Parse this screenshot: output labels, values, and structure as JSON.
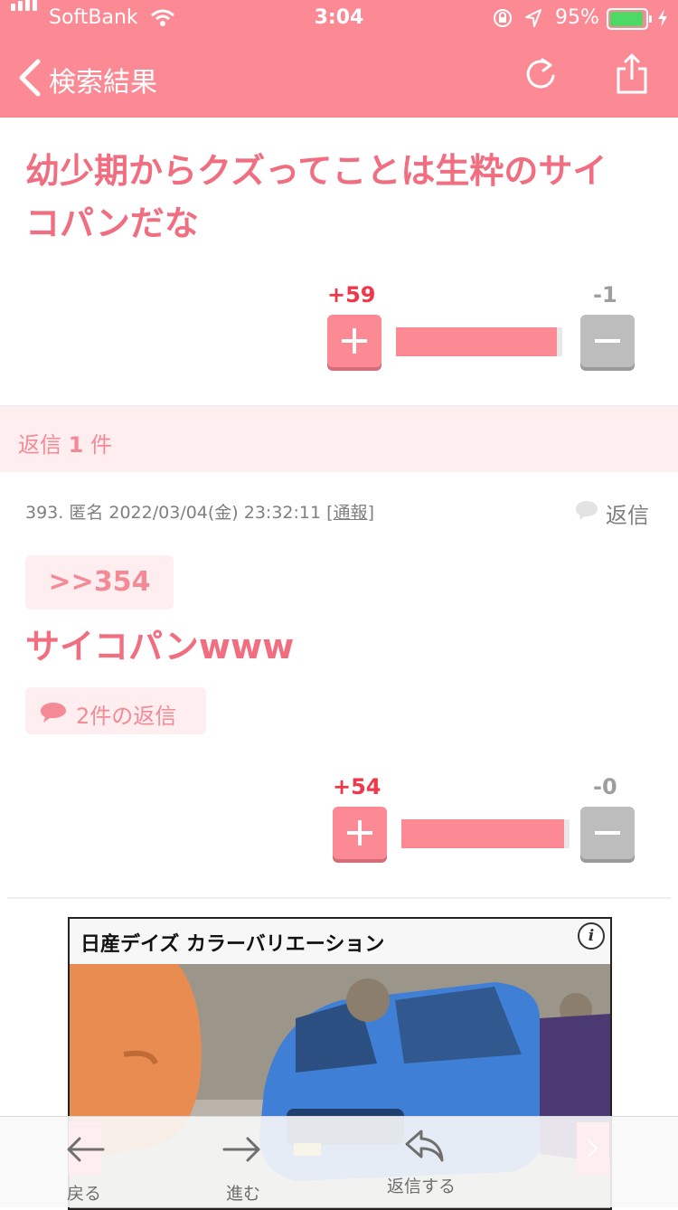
{
  "status": {
    "carrier": "SoftBank",
    "time": "3:04",
    "battery": "95%"
  },
  "nav": {
    "title": "検索結果",
    "back_icon": "chevron-left-icon",
    "reload_icon": "reload-icon",
    "share_icon": "share-icon"
  },
  "post": {
    "title_line1": "幼少期からクズってことは生粋のサイ",
    "title_line2": "コパンだな",
    "plus_count": "+59",
    "minus_count": "-1",
    "ratio": 0.98
  },
  "replies_header": {
    "prefix": "返信 ",
    "count": "1",
    "suffix": " 件"
  },
  "comment": {
    "meta_prefix": "393. 匿名 2022/03/04(金) 23:32:11 [",
    "report": "通報",
    "meta_suffix": "]",
    "reply_label": "返信",
    "anchor": ">>354",
    "text": "サイコパンwww",
    "replies_label": "2件の返信",
    "plus_count": "+54",
    "minus_count": "-0",
    "ratio": 1.0
  },
  "ad": {
    "title": "日産デイズ カラーバリエーション",
    "info": "i"
  },
  "toolbar": {
    "back": "戻る",
    "forward": "進む",
    "reply": "返信する"
  },
  "colors": {
    "accent": "#fb8a95",
    "text_pink": "#f16d80",
    "plus_red": "#f0384a",
    "light_pink": "#ffeef0"
  }
}
